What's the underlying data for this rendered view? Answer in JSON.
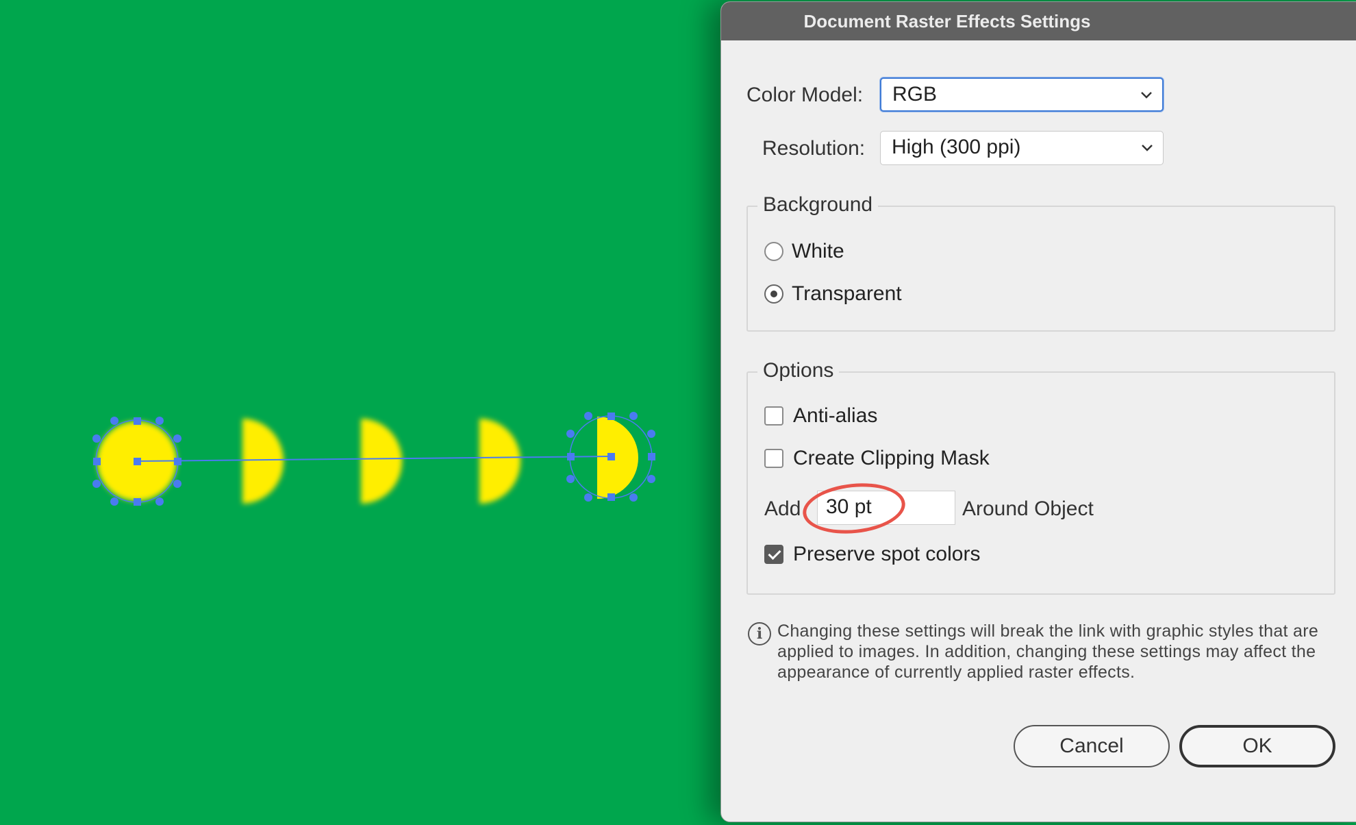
{
  "dialog": {
    "title": "Document Raster Effects Settings",
    "color_model": {
      "label": "Color Model:",
      "value": "RGB"
    },
    "resolution": {
      "label": "Resolution:",
      "value": "High (300 ppi)"
    },
    "background": {
      "legend": "Background",
      "options": [
        {
          "label": "White",
          "selected": false
        },
        {
          "label": "Transparent",
          "selected": true
        }
      ]
    },
    "options": {
      "legend": "Options",
      "anti_alias": {
        "label": "Anti-alias",
        "checked": false
      },
      "clipping_mask": {
        "label": "Create Clipping Mask",
        "checked": false
      },
      "add_label": "Add",
      "add_value": "30 pt",
      "around_label": "Around Object",
      "preserve_spot": {
        "label": "Preserve spot colors",
        "checked": true
      }
    },
    "info_note": "Changing these settings will break the link with graphic styles that are applied to images. In addition, changing these settings may affect the appearance of currently applied raster effects.",
    "buttons": {
      "cancel": "Cancel",
      "ok": "OK"
    }
  },
  "colors": {
    "canvas": "#00a64d",
    "shape": "#ffee00",
    "selection": "#4a7bf0",
    "annotation": "#e8544a"
  },
  "icons": [
    "chevron-down-icon",
    "info-icon",
    "radio-selected",
    "checkbox-checked"
  ]
}
